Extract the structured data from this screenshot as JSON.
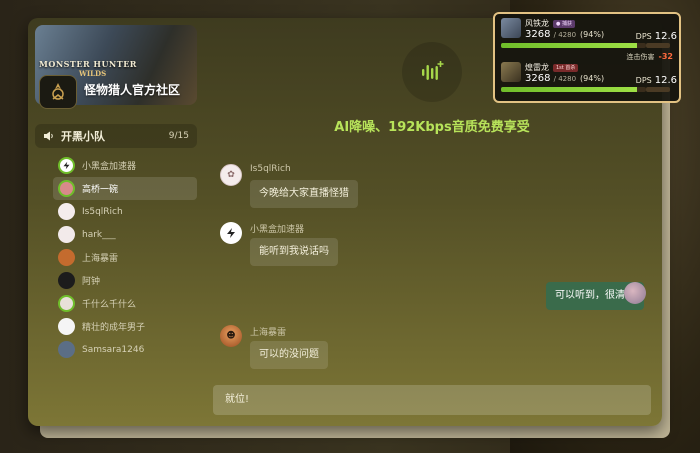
{
  "community": {
    "banner_title": "MONSTER HUNTER",
    "banner_subtitle": "WILDS",
    "name": "怪物猎人官方社区"
  },
  "channel": {
    "name": "开黑小队",
    "count": "9/15",
    "icon": "speaker-icon"
  },
  "members": [
    {
      "name": "小黑盒加速器",
      "avatar": "accelerator-avatar",
      "color": "#ffffff",
      "active": false
    },
    {
      "name": "高桥一碗",
      "avatar": "pink-avatar",
      "color": "#d98a8a",
      "active": true
    },
    {
      "name": "Is5qlRich",
      "avatar": "sketch-avatar",
      "color": "#f4ecec",
      "active": false
    },
    {
      "name": "hark___",
      "avatar": "sketch-avatar",
      "color": "#f2eaea",
      "active": false
    },
    {
      "name": "上海暴雷",
      "avatar": "photo-avatar",
      "color": "#c46b2e",
      "active": false
    },
    {
      "name": "阿钟",
      "avatar": "dark-avatar",
      "color": "#1c1c1c",
      "active": false
    },
    {
      "name": "千什么千什么",
      "avatar": "flower-avatar",
      "color": "#e8e0d8",
      "active": false
    },
    {
      "name": "精壮的成年男子",
      "avatar": "white-avatar",
      "color": "#f5f5f5",
      "active": false
    },
    {
      "name": "Samsara1246",
      "avatar": "grey-avatar",
      "color": "#5b6e86",
      "active": false
    }
  ],
  "promo": "AI降噪、192Kbps音质免费享受",
  "messages": [
    {
      "sender": "Is5qlRich",
      "text": "今晚给大家直播怪猎"
    },
    {
      "sender": "小黑盒加速器",
      "text": "能听到我说话吗"
    },
    {
      "sender": "",
      "text": "可以听到，很清楚"
    },
    {
      "sender": "上海暴雷",
      "text": "可以的没问题"
    }
  ],
  "input_text": "就位!",
  "monsters": [
    {
      "name": "风铁龙",
      "tag": "● 捕获",
      "hp": "3268",
      "max": "/ 4280",
      "pct": "(94%)",
      "dps_label": "DPS",
      "dps": "12.6",
      "fill": 0.94
    },
    {
      "name": "煌雷龙",
      "tag": "1st 首杀",
      "hp": "3268",
      "max": "/ 4280",
      "pct": "(94%)",
      "dps_label": "DPS",
      "dps": "12.6",
      "fill": 0.94
    }
  ],
  "combo": {
    "label": "连击伤害",
    "value": "-32"
  },
  "colors": {
    "accent_green": "#b7e35a",
    "my_bubble": "#3a6b4b",
    "panel_border": "#e2c283"
  }
}
